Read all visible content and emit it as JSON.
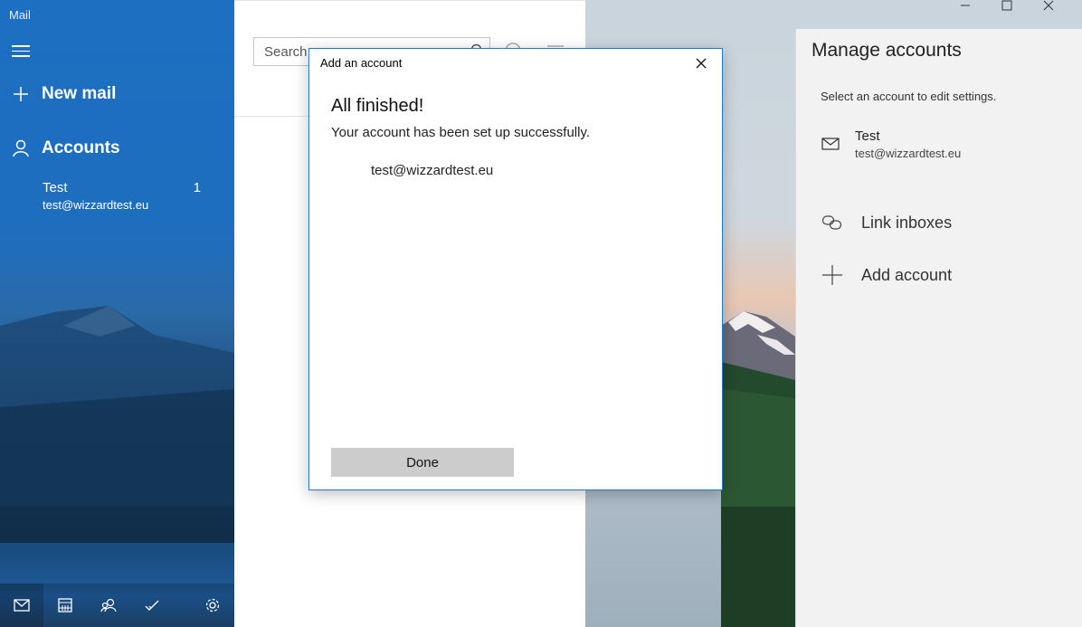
{
  "app": {
    "title": "Mail"
  },
  "nav": {
    "new_mail": "New mail",
    "accounts_label": "Accounts",
    "account": {
      "name": "Test",
      "email": "test@wizzardtest.eu",
      "unread": "1"
    },
    "bottom_icons": [
      "mail-icon",
      "calendar-icon",
      "people-icon",
      "todo-icon",
      "settings-icon"
    ]
  },
  "list": {
    "search_placeholder": "Search"
  },
  "manage": {
    "title": "Manage accounts",
    "subtitle": "Select an account to edit settings.",
    "account": {
      "name": "Test",
      "email": "test@wizzardtest.eu"
    },
    "link_inboxes": "Link inboxes",
    "add_account": "Add account"
  },
  "dialog": {
    "title": "Add an account",
    "heading": "All finished!",
    "message": "Your account has been set up successfully.",
    "email": "test@wizzardtest.eu",
    "done_label": "Done"
  },
  "colors": {
    "accent": "#1f78d1",
    "nav_blue": "#1e6ebf",
    "panel_bg": "#f2f2f2"
  }
}
